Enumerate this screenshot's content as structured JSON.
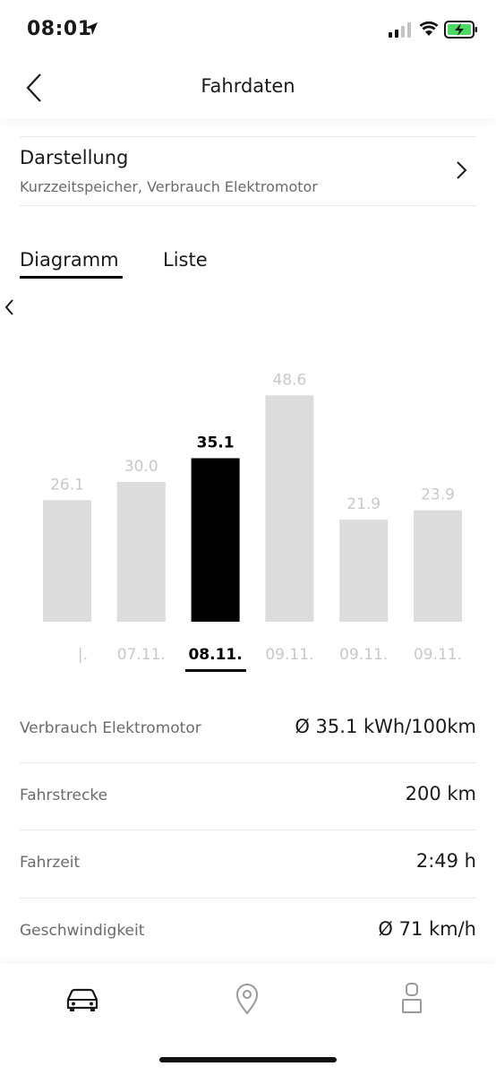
{
  "status_bar": {
    "time": "08:01",
    "icons": [
      "location-arrow-icon",
      "signal-icon",
      "wifi-icon",
      "battery-charging-icon"
    ],
    "battery_color": "#4cd964"
  },
  "nav": {
    "title": "Fahrdaten",
    "back_icon": "chevron-left-icon"
  },
  "darstellung": {
    "title": "Darstellung",
    "subtitle": "Kurzzeitspeicher, Verbrauch Elektromotor",
    "chevron_icon": "chevron-right-icon"
  },
  "tabs": [
    {
      "label": "Diagramm",
      "active": true
    },
    {
      "label": "Liste",
      "active": false
    }
  ],
  "chart_data": {
    "type": "bar",
    "categories": [
      "…",
      "07.11.",
      "08.11.",
      "09.11.",
      "09.11.",
      "09.11."
    ],
    "category_labels": [
      "|.",
      "07.11.",
      "08.11.",
      "09.11.",
      "09.11.",
      "09.11."
    ],
    "values": [
      26.1,
      30.0,
      35.1,
      48.6,
      21.9,
      23.9
    ],
    "value_labels": [
      "26.1",
      "30.0",
      "35.1",
      "48.6",
      "21.9",
      "23.9"
    ],
    "selected_index": 2,
    "bar_color": "#dcdcdc",
    "selected_color": "#000000",
    "label_color": "#c8c8c8",
    "ylim": [
      0,
      50
    ],
    "grid": false
  },
  "stats": [
    {
      "label": "Verbrauch Elektromotor",
      "value": "Ø 35.1 kWh/100km"
    },
    {
      "label": "Fahrstrecke",
      "value": "200 km"
    },
    {
      "label": "Fahrzeit",
      "value": "2:49 h"
    },
    {
      "label": "Geschwindigkeit",
      "value": "Ø 71 km/h"
    }
  ],
  "tabbar": {
    "items": [
      {
        "icon": "car-icon",
        "active": true
      },
      {
        "icon": "location-pin-icon",
        "active": false
      },
      {
        "icon": "user-icon",
        "active": false
      }
    ],
    "active_color": "#1a1a1a",
    "inactive_color": "#9a9a9a"
  }
}
